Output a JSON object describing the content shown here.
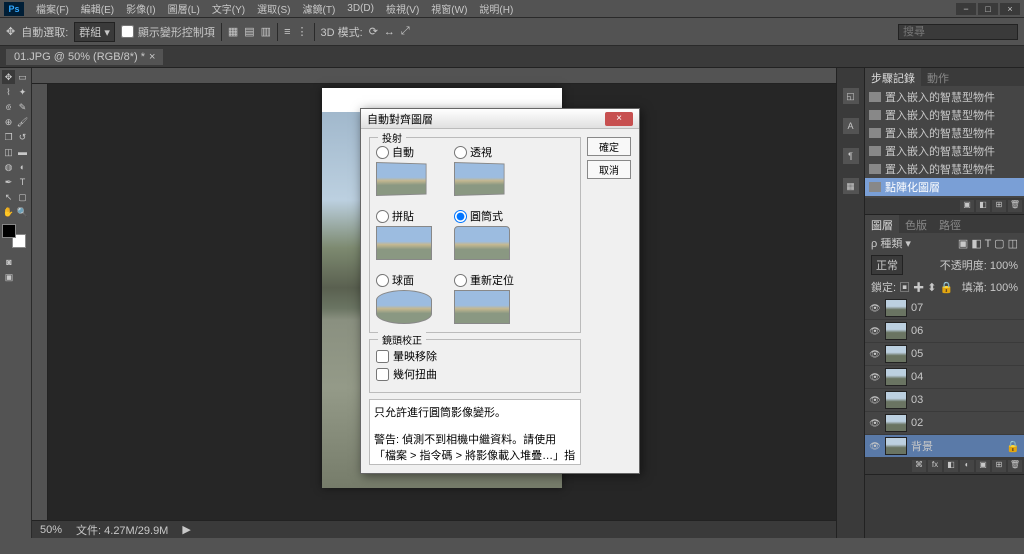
{
  "menu": {
    "items": [
      "檔案(F)",
      "編輯(E)",
      "影像(I)",
      "圖層(L)",
      "文字(Y)",
      "選取(S)",
      "濾鏡(T)",
      "3D(D)",
      "檢視(V)",
      "視窗(W)",
      "說明(H)"
    ]
  },
  "win": {
    "min": "−",
    "max": "□",
    "close": "×"
  },
  "optbar": {
    "label": "自動選取:",
    "combo": "群組 ▾",
    "check": "顯示變形控制項",
    "mode3d": "3D 模式:",
    "search_placeholder": "搜尋"
  },
  "doctab": {
    "title": "01.JPG @ 50% (RGB/8*) *",
    "close": "×"
  },
  "status": {
    "zoom": "50%",
    "size": "文件: 4.27M/29.9M",
    "arrow": "▶"
  },
  "panel_actions": {
    "tab_actions": "步驟記錄",
    "tab_comps": "動作",
    "items": [
      "置入嵌入的智慧型物件",
      "置入嵌入的智慧型物件",
      "置入嵌入的智慧型物件",
      "置入嵌入的智慧型物件",
      "置入嵌入的智慧型物件"
    ],
    "sel": "點陣化圖層"
  },
  "panel_props": {
    "tab1": "圖層",
    "tab2": "色版",
    "tab3": "路徑",
    "kind": "種類",
    "blend": "正常",
    "opacity_lbl": "不透明度:",
    "opacity": "100%",
    "lock_lbl": "鎖定:",
    "fill_lbl": "填滿:",
    "fill": "100%"
  },
  "layers": {
    "items": [
      {
        "name": "07"
      },
      {
        "name": "06"
      },
      {
        "name": "05"
      },
      {
        "name": "04"
      },
      {
        "name": "03"
      },
      {
        "name": "02"
      }
    ],
    "bg": "背景",
    "lock": "🔒"
  },
  "dialog": {
    "title": "自動對齊圖層",
    "ok": "確定",
    "cancel": "取消",
    "group_proj": "投射",
    "opts": [
      "自動",
      "透視",
      "拼貼",
      "圓筒式",
      "球面",
      "重新定位"
    ],
    "group_lens": "鏡頭校正",
    "chk_vignette": "暈映移除",
    "chk_geo": "幾何扭曲",
    "note1": "只允許進行圓筒影像變形。",
    "note2": "警告: 偵測不到相機中繼資料。請使用「檔案 > 指令碼 > 將影像載入堆疊…」指令碼，保留中繼資料以便用於暈映移除和/或幾何扭曲。"
  }
}
